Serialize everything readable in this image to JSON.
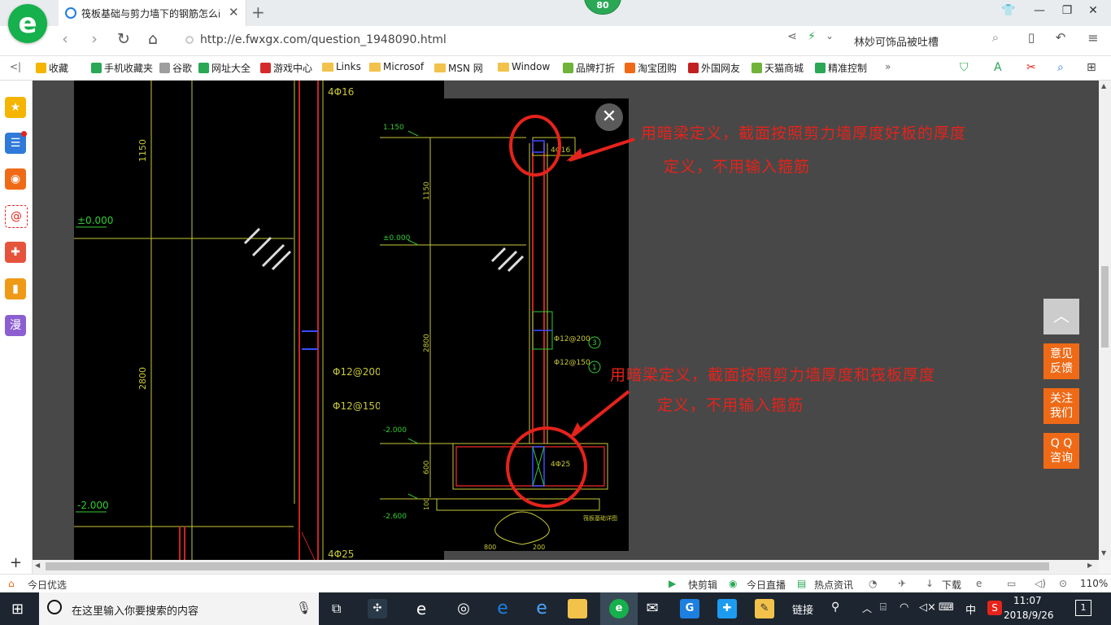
{
  "browser": {
    "badge": "80",
    "tab_title": "筏板基础与剪力墙下的钢筋怎么画",
    "tab_close": "✕",
    "new_tab": "+",
    "url": "http://e.fwxgx.com/question_1948090.html",
    "search_text": "林妙可饰品被吐槽"
  },
  "bookmarks": [
    {
      "label": "收藏",
      "color": "#f4b400"
    },
    {
      "label": "手机收藏夹",
      "color": "#2aa855"
    },
    {
      "label": "谷歌",
      "color": "#9e9e9e"
    },
    {
      "label": "网址大全",
      "color": "#2aa855"
    },
    {
      "label": "游戏中心",
      "color": "#d62a2a"
    },
    {
      "label": "Links",
      "color": "folder"
    },
    {
      "label": "Microsof",
      "color": "folder"
    },
    {
      "label": "MSN 网",
      "color": "folder"
    },
    {
      "label": "Window",
      "color": "folder"
    },
    {
      "label": "品牌打折",
      "color": "#6fb33a"
    },
    {
      "label": "淘宝团购",
      "color": "#ef6a16"
    },
    {
      "label": "外国网友",
      "color": "#c21f1f"
    },
    {
      "label": "天猫商城",
      "color": "#6fb33a"
    },
    {
      "label": "精准控制",
      "color": "#2aa855"
    }
  ],
  "bookmarks_more": "»",
  "sidebar_icons": [
    "star-icon",
    "news-icon",
    "weibo-icon",
    "mail-icon",
    "game-icon",
    "book-icon",
    "comic-icon"
  ],
  "sidebar_comic_label": "漫",
  "sidebar_add": "+",
  "content": {
    "annotation_top_line1": "用暗梁定义，截面按照剪力墙厚度好板的厚度",
    "annotation_top_line2": "定义，不用输入箍筋",
    "annotation_bottom_line1": "用暗梁定义，截面按照剪力墙厚度和筏板厚度",
    "annotation_bottom_line2": "定义，不用输入箍筋",
    "close": "✕",
    "cad_left": {
      "dim_1150": "1150",
      "elev_0": "±0.000",
      "rebar_top": "4Φ16",
      "dim_2800": "2800",
      "rebar_200": "Φ12@200",
      "rebar_150": "Φ12@150",
      "elev_m2": "-2.000",
      "rebar_bottom": "4Φ25"
    },
    "cad_popup": {
      "elev_1150": "1.150",
      "dim_1150": "1150",
      "elev_0": "±0.000",
      "rebar_top": "4Φ16",
      "dim_2800": "2800",
      "rebar_200": "Φ12@200",
      "rebar_150": "Φ12@150",
      "mark_3": "3",
      "mark_1": "1",
      "elev_m2": "-2.000",
      "dim_600": "600",
      "rebar_bottom": "4Φ25",
      "elev_m26": "-2.600",
      "dim_100": "100",
      "dim_800": "800",
      "dim_200": "200",
      "section_label": "筏板基础详图"
    },
    "float_buttons": {
      "top_arrow": "︿",
      "feedback": "意见\n反馈",
      "follow": "关注\n我们",
      "qq": "Q Q\n咨询"
    }
  },
  "status": {
    "today": "今日优选",
    "kuaijian": "快剪辑",
    "live": "今日直播",
    "hot": "热点资讯",
    "download": "下载",
    "zoom": "110%"
  },
  "taskbar": {
    "search_placeholder": "在这里输入你要搜索的内容",
    "link": "链接",
    "ime": "中",
    "time": "11:07",
    "date": "2018/9/26",
    "notify_count": "1"
  }
}
